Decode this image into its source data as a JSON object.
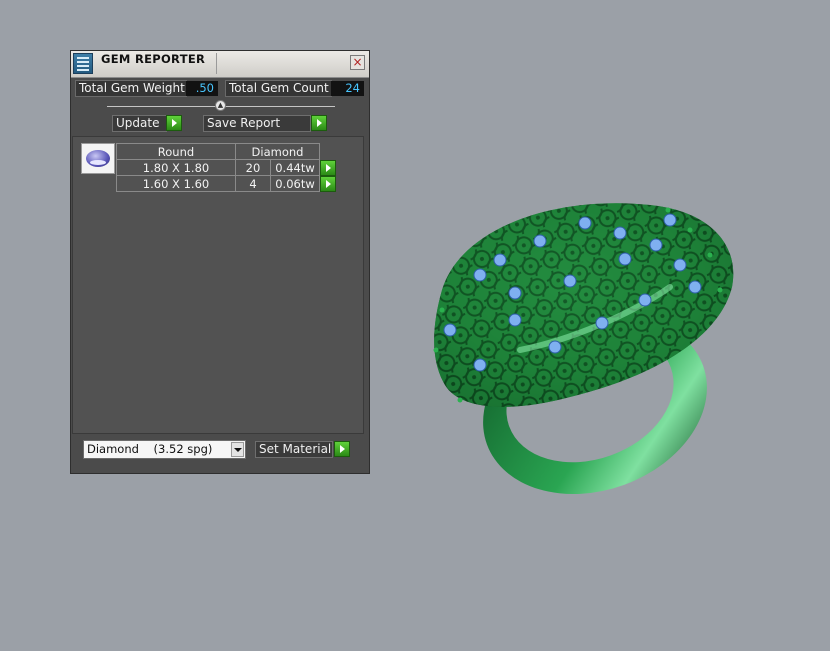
{
  "window": {
    "title": "GEM REPORTER",
    "close_symbol": "×",
    "icon": "gem-reporter-app-icon"
  },
  "summary": {
    "weight_label": "Total Gem Weight",
    "weight_value": ".50",
    "count_label": "Total Gem Count",
    "count_value": "24"
  },
  "toolbar": {
    "update_label": "Update",
    "save_report_label": "Save Report"
  },
  "gem_table": {
    "headers": {
      "shape": "Round",
      "material": "Diamond"
    },
    "rows": [
      {
        "size": "1.80 X 1.80",
        "count": "20",
        "weight": "0.44tw"
      },
      {
        "size": "1.60 X 1.60",
        "count": "4",
        "weight": "0.06tw"
      }
    ]
  },
  "material": {
    "selected": "Diamond    (3.52 spg)",
    "set_label": "Set Material"
  },
  "colors": {
    "accent_value": "#48c6ff",
    "ring_metal": "#1f8a3c",
    "gem_stones": "#7fb0f0",
    "viewport_bg": "#9ba0a7"
  }
}
